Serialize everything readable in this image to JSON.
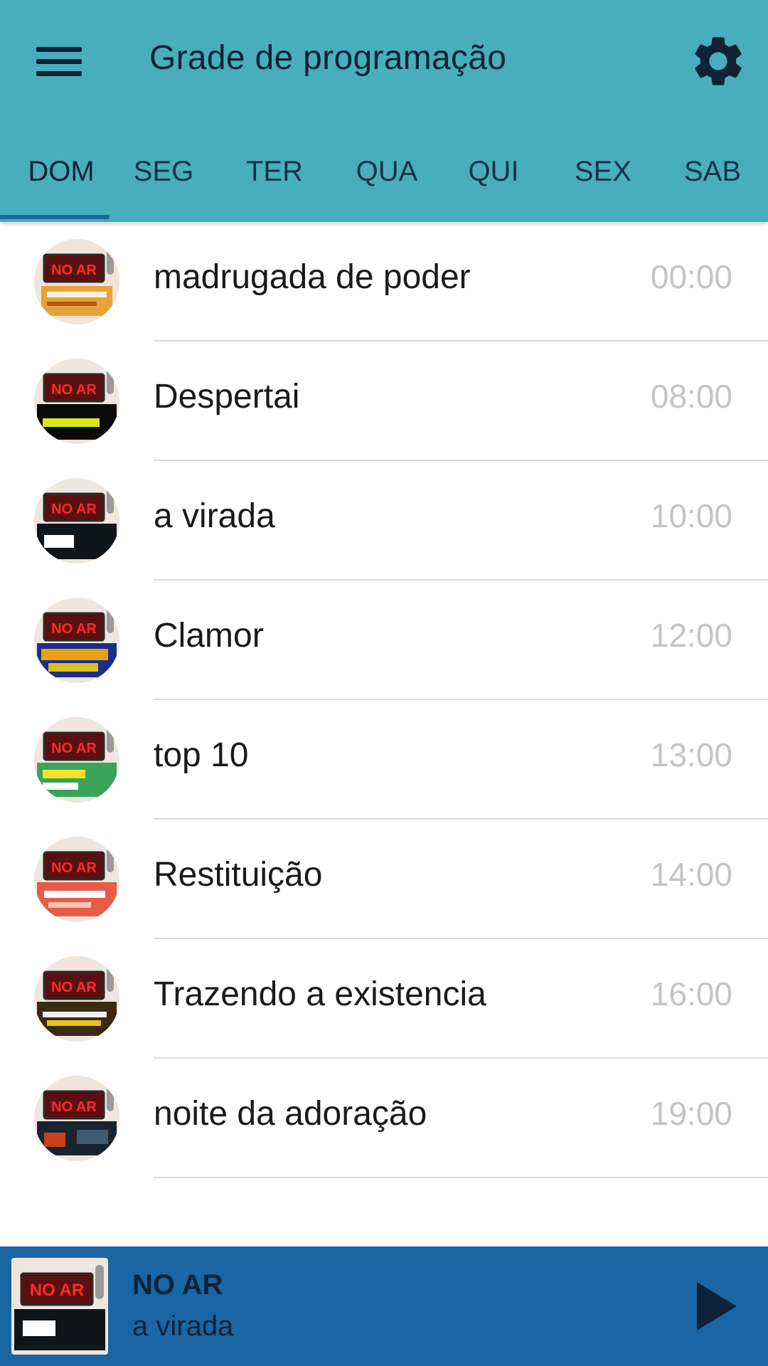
{
  "header": {
    "title": "Grade de programação",
    "menu_icon": "hamburger-menu-icon",
    "settings_icon": "gear-icon"
  },
  "tabs": [
    {
      "label": "DOM",
      "active": true
    },
    {
      "label": "SEG",
      "active": false
    },
    {
      "label": "TER",
      "active": false
    },
    {
      "label": "QUA",
      "active": false
    },
    {
      "label": "QUI",
      "active": false
    },
    {
      "label": "SEX",
      "active": false
    },
    {
      "label": "SAB",
      "active": false
    }
  ],
  "schedule": [
    {
      "title": "madrugada de poder",
      "time": "00:00",
      "thumb_text": "NO AR"
    },
    {
      "title": "Despertai",
      "time": "08:00",
      "thumb_text": "NO AR"
    },
    {
      "title": "a virada",
      "time": "10:00",
      "thumb_text": "NO AR"
    },
    {
      "title": "Clamor",
      "time": "12:00",
      "thumb_text": "NO AR"
    },
    {
      "title": "top 10",
      "time": "13:00",
      "thumb_text": "NO AR"
    },
    {
      "title": "Restituição",
      "time": "14:00",
      "thumb_text": "NO AR"
    },
    {
      "title": "Trazendo a existencia",
      "time": "16:00",
      "thumb_text": "NO AR"
    },
    {
      "title": "noite da adoração",
      "time": "19:00",
      "thumb_text": "NO AR"
    }
  ],
  "player": {
    "status": "NO AR",
    "title": "a virada",
    "thumb_text": "NO AR",
    "play_icon": "play-icon"
  },
  "colors": {
    "header_bg": "#48aebd",
    "player_bg": "#1a65a3",
    "tab_indicator": "#1c65a6",
    "text_dark": "#0e2238",
    "time_gray": "#c4c4c4"
  }
}
